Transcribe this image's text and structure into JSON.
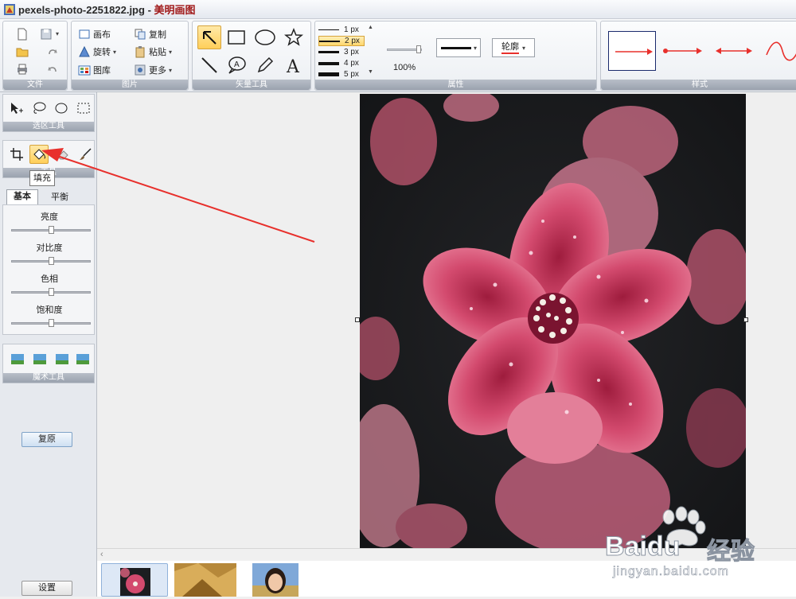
{
  "window": {
    "filename": "pexels-photo-2251822.jpg",
    "separator": " - ",
    "app_name": "美明画图"
  },
  "ribbon": {
    "groups": {
      "file": "文件",
      "image": "图片",
      "shapes": "矢量工具",
      "properties": "属性",
      "styles": "样式"
    },
    "image_buttons": {
      "canvas": "画布",
      "copy": "复制",
      "rotate": "旋转",
      "paste": "粘贴",
      "gallery": "图库",
      "more": "更多"
    },
    "line_widths": [
      "1 px",
      "2 px",
      "3 px",
      "4 px",
      "5 px"
    ],
    "selected_line_width": "2 px",
    "opacity": "100%",
    "outline_label": "轮廓"
  },
  "left_panel": {
    "select_tools_label": "选区工具",
    "tools_label": "工具",
    "tooltip": "填充",
    "tabs": {
      "basic": "基本",
      "balance": "平衡"
    },
    "sliders": [
      {
        "label": "亮度",
        "value": 0.5
      },
      {
        "label": "对比度",
        "value": 0.5
      },
      {
        "label": "色相",
        "value": 0.5
      },
      {
        "label": "饱和度",
        "value": 0.5
      }
    ],
    "magic_label": "魔术工具",
    "restore_button": "复原",
    "settings_button": "设置"
  },
  "watermark": {
    "brand": "Baidu",
    "brand_cn": "经验",
    "url": "jingyan.baidu.com"
  },
  "colors": {
    "accent_red": "#e8302c",
    "selection_yellow": "#ffd66b",
    "flower_pink": "#d9466d"
  }
}
